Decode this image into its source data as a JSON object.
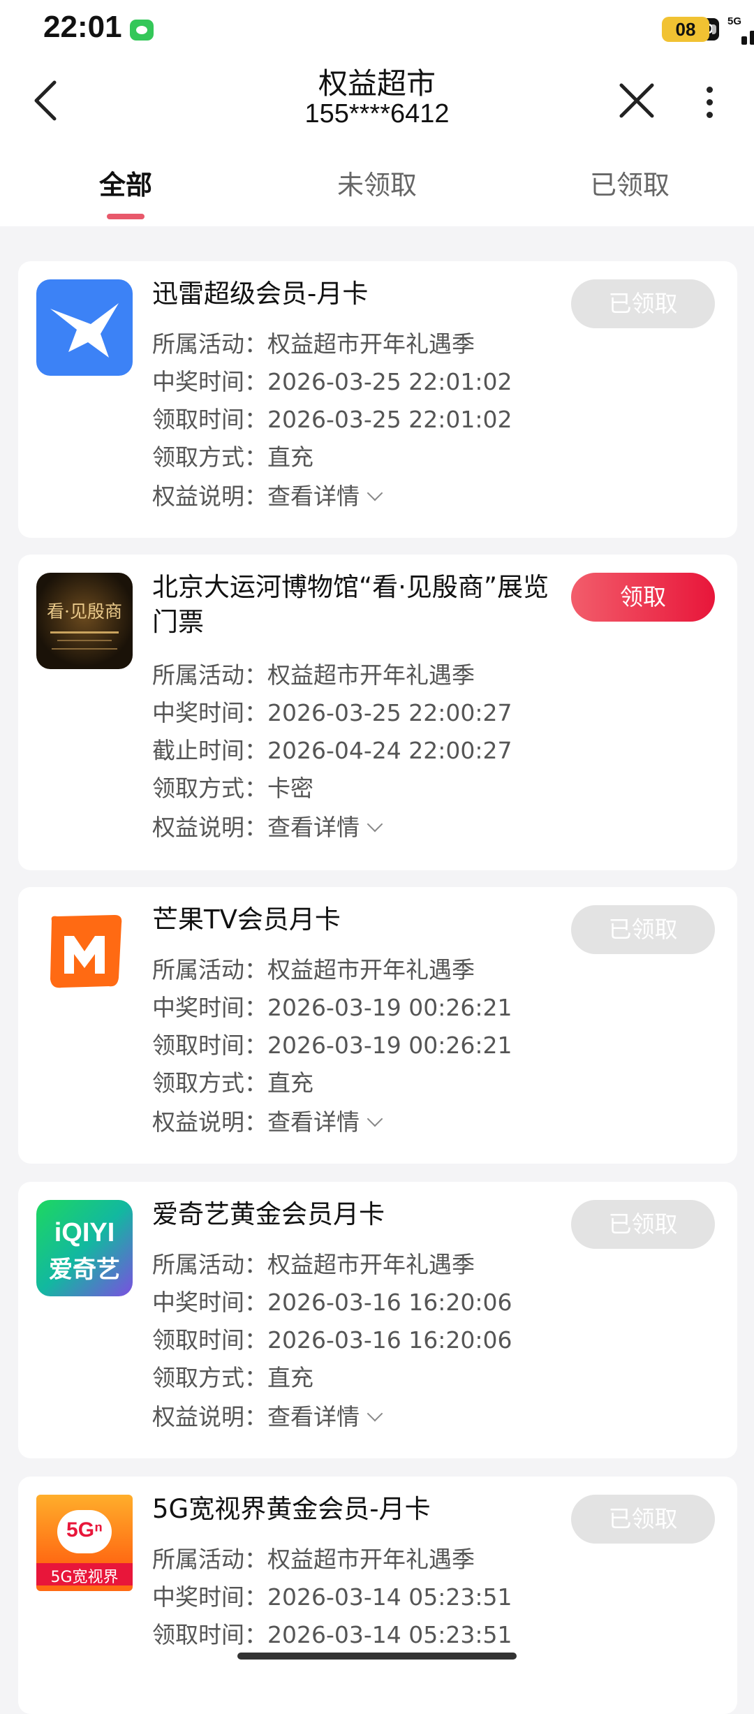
{
  "status_bar": {
    "time": "22:01",
    "hd_label": "HD",
    "signal1_label": "5G",
    "signal2_label": "5G",
    "battery": "08"
  },
  "header": {
    "title": "权益超市",
    "subtitle": "155****6412"
  },
  "tabs": [
    {
      "label": "全部"
    },
    {
      "label": "未领取"
    },
    {
      "label": "已领取"
    }
  ],
  "labels": {
    "activity": "所属活动：",
    "win_time": "中奖时间：",
    "claim_time": "领取时间：",
    "deadline": "截止时间：",
    "method": "领取方式：",
    "desc": "权益说明：",
    "detail_link": "查看详情"
  },
  "cards": [
    {
      "title": "迅雷超级会员-月卡",
      "activity": "权益超市开年礼遇季",
      "win_time": "2026-03-25 22:01:02",
      "time2": "2026-03-25 22:01:02",
      "method": "直充",
      "button": "已领取",
      "logo": "xunlei-logo",
      "logo_color": "#3c82f6"
    },
    {
      "title": "北京大运河博物馆“看·见殷商”展览门票",
      "activity": "权益超市开年礼遇季",
      "win_time": "2026-03-25 22:00:27",
      "time2": "2026-04-24 22:00:27",
      "method": "卡密",
      "button": "领取",
      "logo": "exhibition-poster",
      "logo_text": "看·见殷商"
    },
    {
      "title": "芒果TV会员月卡",
      "activity": "权益超市开年礼遇季",
      "win_time": "2026-03-19 00:26:21",
      "time2": "2026-03-19 00:26:21",
      "method": "直充",
      "button": "已领取",
      "logo": "mango-tv-logo",
      "logo_color": "#ff6a13"
    },
    {
      "title": "爱奇艺黄金会员月卡",
      "activity": "权益超市开年礼遇季",
      "win_time": "2026-03-16 16:20:06",
      "time2": "2026-03-16 16:20:06",
      "method": "直充",
      "button": "已领取",
      "logo": "iqiyi-logo",
      "logo_text_top": "iQIYI",
      "logo_text_bottom": "爱奇艺"
    },
    {
      "title": "5G宽视界黄金会员-月卡",
      "activity": "权益超市开年礼遇季",
      "win_time": "2026-03-14 05:23:51",
      "time2": "2026-03-14 05:23:51",
      "button": "已领取",
      "logo": "5g-vision-logo",
      "logo_text_top": "5Gⁿ",
      "logo_text_bottom": "5G宽视界"
    }
  ]
}
